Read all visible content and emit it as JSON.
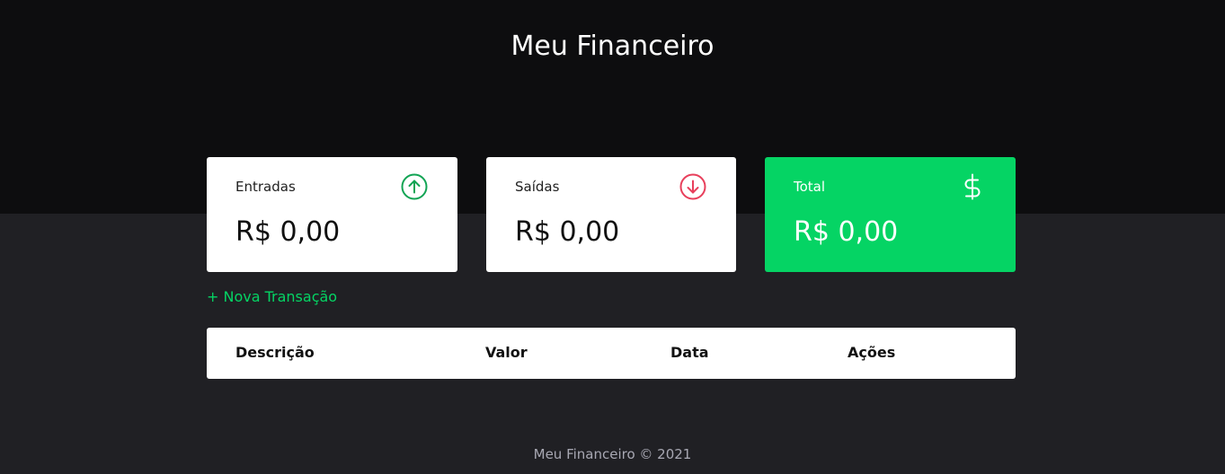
{
  "header": {
    "title": "Meu Financeiro"
  },
  "summary": {
    "income": {
      "label": "Entradas",
      "value": "R$ 0,00",
      "icon": "arrow-up-circle-icon",
      "color": "#12a454"
    },
    "expense": {
      "label": "Saídas",
      "value": "R$ 0,00",
      "icon": "arrow-down-circle-icon",
      "color": "#e83f5b"
    },
    "total": {
      "label": "Total",
      "value": "R$ 0,00",
      "icon": "dollar-icon",
      "color": "#05d464"
    }
  },
  "actions": {
    "new_transaction_label": "+ Nova Transação"
  },
  "table": {
    "columns": [
      "Descrição",
      "Valor",
      "Data",
      "Ações"
    ],
    "rows": []
  },
  "footer": {
    "text": "Meu Financeiro © 2021"
  }
}
